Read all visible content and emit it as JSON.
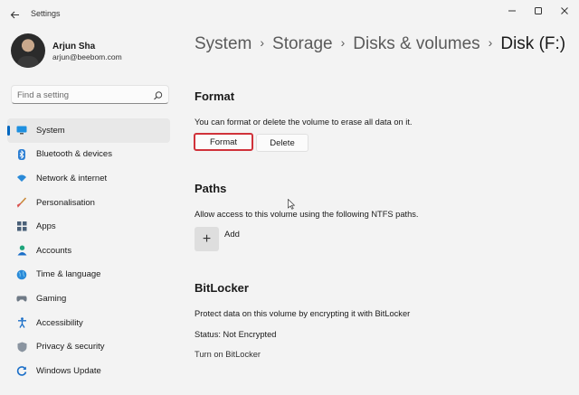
{
  "window": {
    "title": "Settings",
    "back_icon": "back-arrow-icon",
    "minimize_icon": "minimize-icon",
    "maximize_icon": "maximize-icon",
    "close_icon": "close-icon"
  },
  "profile": {
    "name": "Arjun Sha",
    "email": "arjun@beebom.com"
  },
  "search": {
    "placeholder": "Find a setting"
  },
  "sidebar": {
    "items": [
      {
        "label": "System",
        "icon": "monitor-icon",
        "active": true
      },
      {
        "label": "Bluetooth & devices",
        "icon": "bluetooth-icon"
      },
      {
        "label": "Network & internet",
        "icon": "wifi-icon"
      },
      {
        "label": "Personalisation",
        "icon": "brush-icon"
      },
      {
        "label": "Apps",
        "icon": "apps-icon"
      },
      {
        "label": "Accounts",
        "icon": "person-icon"
      },
      {
        "label": "Time & language",
        "icon": "globe-icon"
      },
      {
        "label": "Gaming",
        "icon": "gamepad-icon"
      },
      {
        "label": "Accessibility",
        "icon": "accessibility-icon"
      },
      {
        "label": "Privacy & security",
        "icon": "shield-icon"
      },
      {
        "label": "Windows Update",
        "icon": "update-icon"
      }
    ]
  },
  "breadcrumb": {
    "items": [
      "System",
      "Storage",
      "Disks & volumes"
    ],
    "current": "Disk (F:)"
  },
  "format": {
    "title": "Format",
    "description": "You can format or delete the volume to erase all data on it.",
    "format_button": "Format",
    "delete_button": "Delete"
  },
  "paths": {
    "title": "Paths",
    "description": "Allow access to this volume using the following NTFS paths.",
    "add_label": "Add"
  },
  "bitlocker": {
    "title": "BitLocker",
    "description": "Protect data on this volume by encrypting it with BitLocker",
    "status": "Status: Not Encrypted",
    "turn_on_link": "Turn on BitLocker"
  },
  "colors": {
    "accent": "#0067c0",
    "highlight_border": "#d0323a"
  }
}
